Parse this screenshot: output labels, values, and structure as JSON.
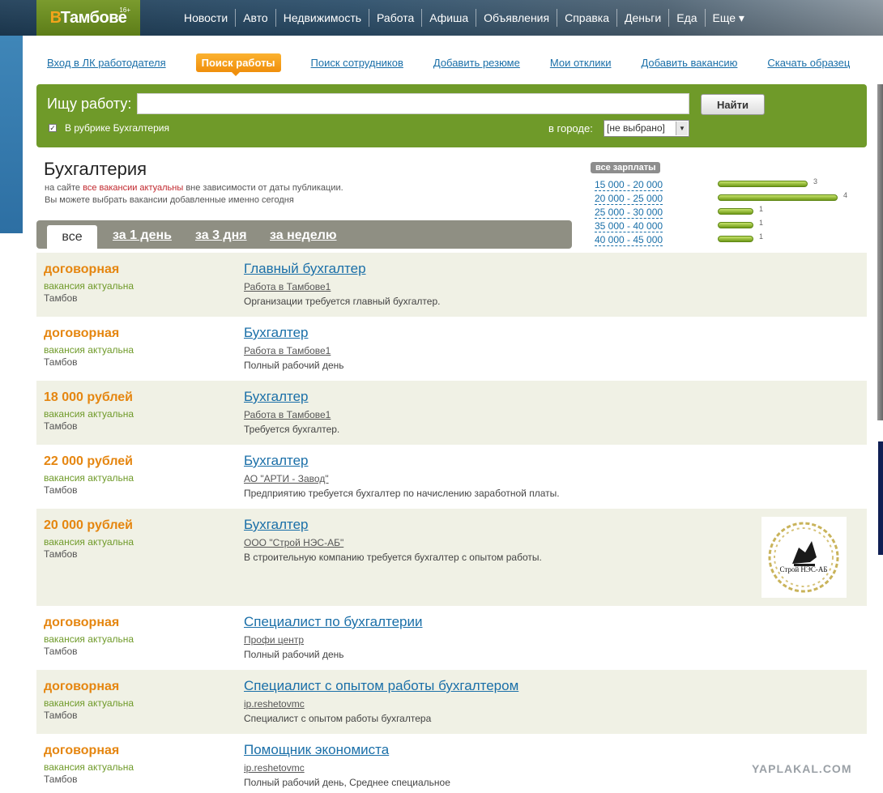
{
  "site": {
    "logo_prefix": "В",
    "logo_name": "Тамбове",
    "age": "16+"
  },
  "nav": [
    "Новости",
    "Авто",
    "Недвижимость",
    "Работа",
    "Афиша",
    "Объявления",
    "Справка",
    "Деньги",
    "Еда",
    "Еще ▾"
  ],
  "subnav": {
    "employer_login": "Вход в ЛК работодателя",
    "job_search": "Поиск работы",
    "staff_search": "Поиск сотрудников",
    "add_resume": "Добавить резюме",
    "my_responses": "Мои отклики",
    "add_vacancy": "Добавить вакансию",
    "download_sample": "Скачать образец"
  },
  "search": {
    "label": "Ищу работу:",
    "value": "",
    "button": "Найти",
    "checkbox_checked": true,
    "checkbox_label": "В рубрике Бухгалтерия",
    "city_label": "в городе:",
    "city_value": "[не выбрано]"
  },
  "category": {
    "title": "Бухгалтерия",
    "note_before": "на сайте ",
    "note_highlight": "все вакансии актуальны",
    "note_after": " вне зависимости от даты публикации.",
    "note2": "Вы можете выбрать вакансии добавленные именно сегодня"
  },
  "salary_filter": {
    "heading": "все зарплаты",
    "ranges": [
      {
        "label": "15 000 - 20 000",
        "count": 3
      },
      {
        "label": "20 000 - 25 000",
        "count": 4
      },
      {
        "label": "25 000 - 30 000",
        "count": 1
      },
      {
        "label": "35 000 - 40 000",
        "count": 1
      },
      {
        "label": "40 000 - 45 000",
        "count": 1
      }
    ],
    "bar_color": "#7fb21d"
  },
  "tabs": {
    "all": "все",
    "day": "за 1 день",
    "three_days": "за 3 дня",
    "week": "за неделю"
  },
  "vacancies": [
    {
      "salary": "договорная",
      "status": "вакансия актуальна",
      "city": "Тамбов",
      "title": "Главный бухгалтер",
      "company": "Работа в Тамбове1",
      "desc": "Организации требуется главный бухгалтер."
    },
    {
      "salary": "договорная",
      "status": "вакансия актуальна",
      "city": "Тамбов",
      "title": "Бухгалтер",
      "company": "Работа в Тамбове1",
      "desc": "Полный рабочий день"
    },
    {
      "salary": "18 000 рублей",
      "status": "вакансия актуальна",
      "city": "Тамбов",
      "title": "Бухгалтер",
      "company": "Работа в Тамбове1",
      "desc": "Требуется бухгалтер."
    },
    {
      "salary": "22 000 рублей",
      "status": "вакансия актуальна",
      "city": "Тамбов",
      "title": "Бухгалтер",
      "company": "АО \"АРТИ - Завод\"",
      "desc": "Предприятию требуется бухгалтер по начислению заработной платы."
    },
    {
      "salary": "20 000 рублей",
      "status": "вакансия актуальна",
      "city": "Тамбов",
      "title": "Бухгалтер",
      "company": "ООО \"Строй НЭС-АБ\"",
      "desc": "В строительную компанию требуется бухгалтер с опытом работы.",
      "logo_text": "Строй НЭС-АБ"
    },
    {
      "salary": "договорная",
      "status": "вакансия актуальна",
      "city": "Тамбов",
      "title": "Специалист по бухгалтерии",
      "company": "Профи центр",
      "desc": "Полный рабочий день"
    },
    {
      "salary": "договорная",
      "status": "вакансия актуальна",
      "city": "Тамбов",
      "title": "Специалист с опытом работы бухгалтером",
      "company": "ip.reshetovmc",
      "desc": "Специалист с опытом работы бухгалтера"
    },
    {
      "salary": "договорная",
      "status": "вакансия актуальна",
      "city": "Тамбов",
      "title": "Помощник экономиста",
      "company": "ip.reshetovmc",
      "desc": "Полный рабочий день, Среднее специальное"
    }
  ],
  "watermark": "YAPLAKAL.COM",
  "colors": {
    "accent_green": "#6f9a29",
    "salary_orange": "#e58610",
    "link_blue": "#1a6fa8",
    "row_alt": "#f0f1e5"
  }
}
